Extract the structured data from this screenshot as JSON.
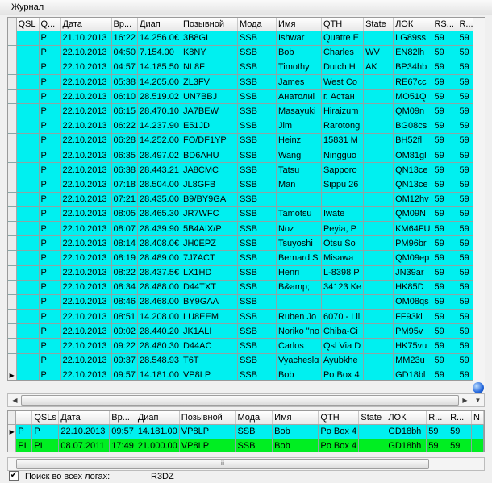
{
  "window": {
    "title": "Журнал"
  },
  "columns_main": [
    "QSL",
    "Q...",
    "Дата",
    "Вр...",
    "Диап",
    "Позывной",
    "Мода",
    "Имя",
    "QTH",
    "State",
    "ЛОК",
    "RS...",
    "R..."
  ],
  "rows_main": [
    [
      "",
      "P",
      "21.10.2013",
      "16:22",
      "14.256.0€",
      "3B8GL",
      "SSB",
      "Ishwar",
      "Quatre E",
      "",
      "LG89ss",
      "59",
      "59"
    ],
    [
      "",
      "P",
      "22.10.2013",
      "04:50",
      "7.154.00",
      "K8NY",
      "SSB",
      "Bob",
      "Charles",
      "WV",
      "EN82lh",
      "59",
      "59"
    ],
    [
      "",
      "P",
      "22.10.2013",
      "04:57",
      "14.185.50",
      "NL8F",
      "SSB",
      "Timothy",
      "Dutch H",
      "AK",
      "BP34hb",
      "59",
      "59"
    ],
    [
      "",
      "P",
      "22.10.2013",
      "05:38",
      "14.205.00",
      "ZL3FV",
      "SSB",
      "James",
      "West Co",
      "",
      "RE67cc",
      "59",
      "59"
    ],
    [
      "",
      "P",
      "22.10.2013",
      "06:10",
      "28.519.02",
      "UN7BBJ",
      "SSB",
      "Анатолиі",
      "г. Астан",
      "",
      "MO51Q",
      "59",
      "59"
    ],
    [
      "",
      "P",
      "22.10.2013",
      "06:15",
      "28.470.10",
      "JA7BEW",
      "SSB",
      "Masayuki",
      "Hiraizum",
      "",
      "QM09n",
      "59",
      "59"
    ],
    [
      "",
      "P",
      "22.10.2013",
      "06:22",
      "14.237.90",
      "E51JD",
      "SSB",
      "Jim",
      "Rarotonɡ",
      "",
      "BG08cs",
      "59",
      "59"
    ],
    [
      "",
      "P",
      "22.10.2013",
      "06:28",
      "14.252.00",
      "FO/DF1YP",
      "SSB",
      "Heinz",
      "15831 M",
      "",
      "BH52fl",
      "59",
      "59"
    ],
    [
      "",
      "P",
      "22.10.2013",
      "06:35",
      "28.497.02",
      "BD6AHU",
      "SSB",
      "Wang",
      "Ningguo",
      "",
      "OM81gl",
      "59",
      "59"
    ],
    [
      "",
      "P",
      "22.10.2013",
      "06:38",
      "28.443.21",
      "JA8CMC",
      "SSB",
      "Tatsu",
      "Sapporo",
      "",
      "QN13ce",
      "59",
      "59"
    ],
    [
      "",
      "P",
      "22.10.2013",
      "07:18",
      "28.504.00",
      "JL8GFB",
      "SSB",
      "Man",
      "Sippu 26",
      "",
      "QN13ce",
      "59",
      "59"
    ],
    [
      "",
      "P",
      "22.10.2013",
      "07:21",
      "28.435.00",
      "B9/BY9GA",
      "SSB",
      "",
      "",
      "",
      "OM12hv",
      "59",
      "59"
    ],
    [
      "",
      "P",
      "22.10.2013",
      "08:05",
      "28.465.30",
      "JR7WFC",
      "SSB",
      "Tamotsu",
      "Iwate",
      "",
      "QM09N",
      "59",
      "59"
    ],
    [
      "",
      "P",
      "22.10.2013",
      "08:07",
      "28.439.90",
      "5B4AIX/P",
      "SSB",
      "Noz",
      "Peyia, P",
      "",
      "KM64FU",
      "59",
      "59"
    ],
    [
      "",
      "P",
      "22.10.2013",
      "08:14",
      "28.408.0€",
      "JH0EPZ",
      "SSB",
      "Tsuyoshi",
      "Otsu So",
      "",
      "PM96br",
      "59",
      "59"
    ],
    [
      "",
      "P",
      "22.10.2013",
      "08:19",
      "28.489.00",
      "7J7ACT",
      "SSB",
      "Bernard S",
      "Misawa",
      "",
      "QM09ep",
      "59",
      "59"
    ],
    [
      "",
      "P",
      "22.10.2013",
      "08:22",
      "28.437.5€",
      "LX1HD",
      "SSB",
      "Henri",
      "L-8398 P",
      "",
      "JN39ar",
      "59",
      "59"
    ],
    [
      "",
      "P",
      "22.10.2013",
      "08:34",
      "28.488.00",
      "D44TXT",
      "SSB",
      "B&amp;",
      "34123 Ke",
      "",
      "HK85D",
      "59",
      "59"
    ],
    [
      "",
      "P",
      "22.10.2013",
      "08:46",
      "28.468.00",
      "BY9GAA",
      "SSB",
      "",
      "",
      "",
      "OM08qs",
      "59",
      "59"
    ],
    [
      "",
      "P",
      "22.10.2013",
      "08:51",
      "14.208.00",
      "LU8EEM",
      "SSB",
      "Ruben Jo",
      "6070 - Lii",
      "",
      "FF93kl",
      "59",
      "59"
    ],
    [
      "",
      "P",
      "22.10.2013",
      "09:02",
      "28.440.20",
      "JK1ALI",
      "SSB",
      "Noriko \"no",
      "Chiba-Ci",
      "",
      "PM95v",
      "59",
      "59"
    ],
    [
      "",
      "P",
      "22.10.2013",
      "09:22",
      "28.480.30",
      "D44AC",
      "SSB",
      "Carlos",
      "Qsl Via D",
      "",
      "HK75vu",
      "59",
      "59"
    ],
    [
      "",
      "P",
      "22.10.2013",
      "09:37",
      "28.548.93",
      "T6T",
      "SSB",
      "Vyacheslɑ",
      "Ayubkhe",
      "",
      "MM23u",
      "59",
      "59"
    ],
    [
      "",
      "P",
      "22.10.2013",
      "09:57",
      "14.181.00",
      "VP8LP",
      "SSB",
      "Bob",
      "Po Box 4",
      "",
      "GD18bl",
      "59",
      "59"
    ]
  ],
  "columns_bottom": [
    "QSLs",
    "Дата",
    "Вр...",
    "Диап",
    "Позывной",
    "Мода",
    "Имя",
    "QTH",
    "State",
    "ЛОК",
    "R...",
    "R...",
    "N"
  ],
  "rows_bottom": [
    [
      "P",
      "P",
      "22.10.2013",
      "09:57",
      "14.181.00",
      "VP8LP",
      "SSB",
      "Bob",
      "Po Box 4",
      "",
      "GD18bh",
      "59",
      "59",
      ""
    ],
    [
      "PL",
      "PL",
      "08.07.2011",
      "17:49",
      "21.000.00",
      "VP8LP",
      "SSB",
      "Bob",
      "Po Box 4",
      "",
      "GD18bh",
      "59",
      "59",
      ""
    ]
  ],
  "footer": {
    "search_all_logs_label": "Поиск во всех логах:",
    "search_all_logs_checked": true,
    "callsign": "R3DZ"
  },
  "colors": {
    "row_bg": "#00f0f0",
    "row_highlight_bg": "#00ee22",
    "current_row_border": "#d24a4a"
  }
}
